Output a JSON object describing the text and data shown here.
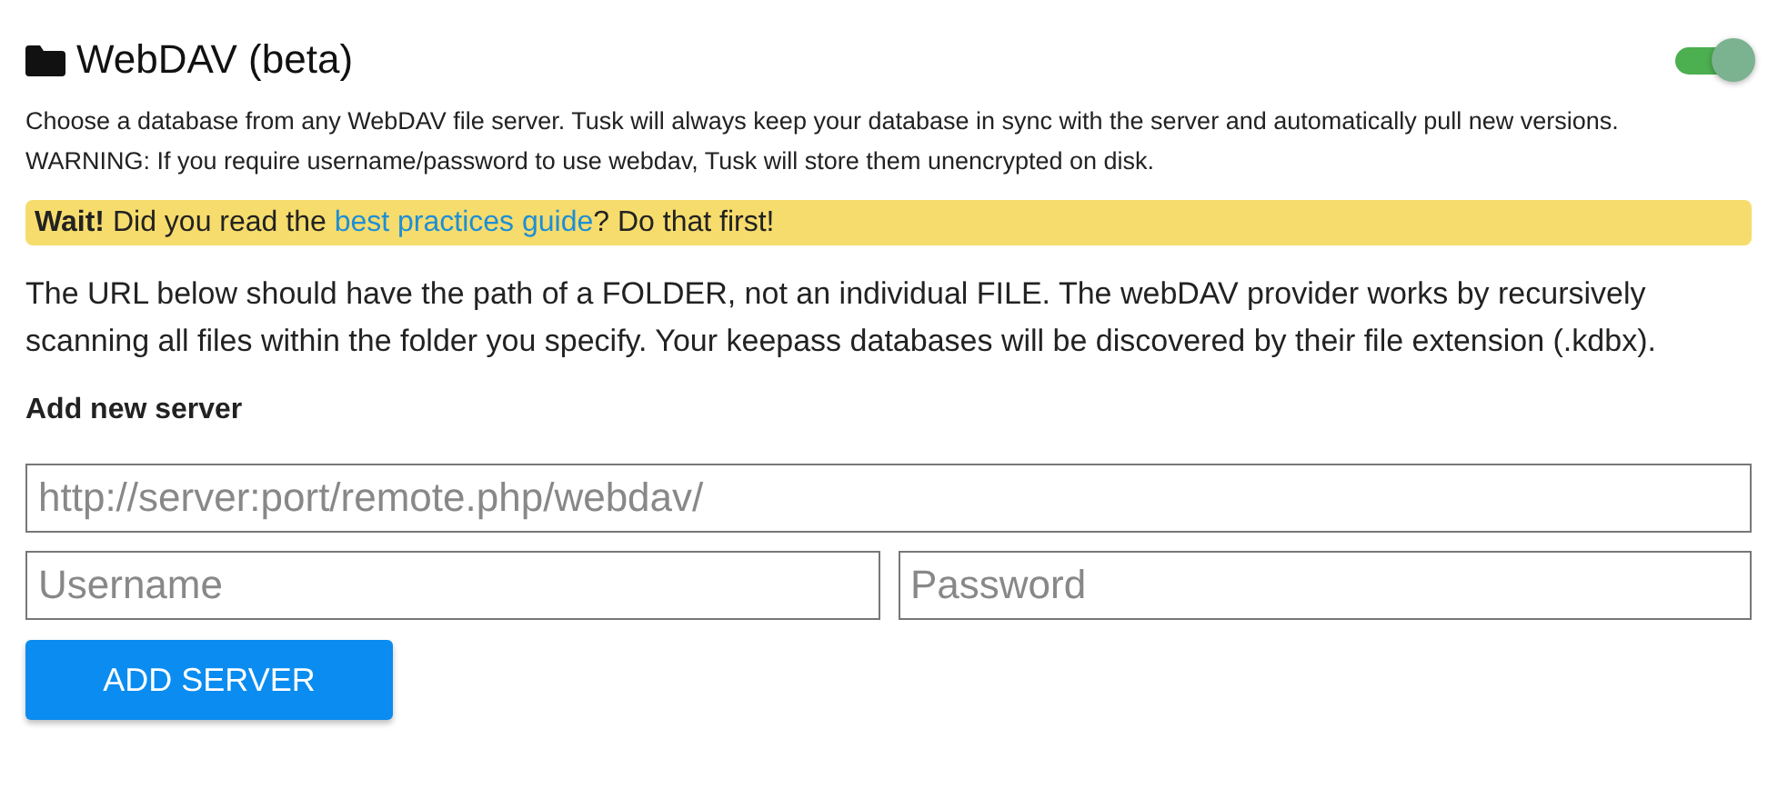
{
  "header": {
    "title": "WebDAV (beta)",
    "enabled": true
  },
  "description": [
    "Choose a database from any WebDAV file server. Tusk will always keep your database in sync with the server and automatically pull new versions.",
    "WARNING: If you require username/password to use webdav, Tusk will store them unencrypted on disk."
  ],
  "notice": {
    "before": "**Wait!** Did you read the ",
    "link": "best practices guide",
    "after": "? Do that first!"
  },
  "explanation": "The URL below should have the path of a FOLDER, not an individual FILE. The webDAV provider works by recursively scanning all files within the folder you specify. Your keepass databases will be discovered by their file extension (.kdbx).",
  "form": {
    "heading": "Add new server",
    "url": {
      "placeholder": "http://server:port/remote.php/webdav/"
    },
    "username": {
      "placeholder": "Username"
    },
    "password": {
      "placeholder": "Password"
    },
    "button": "ADD SERVER"
  }
}
